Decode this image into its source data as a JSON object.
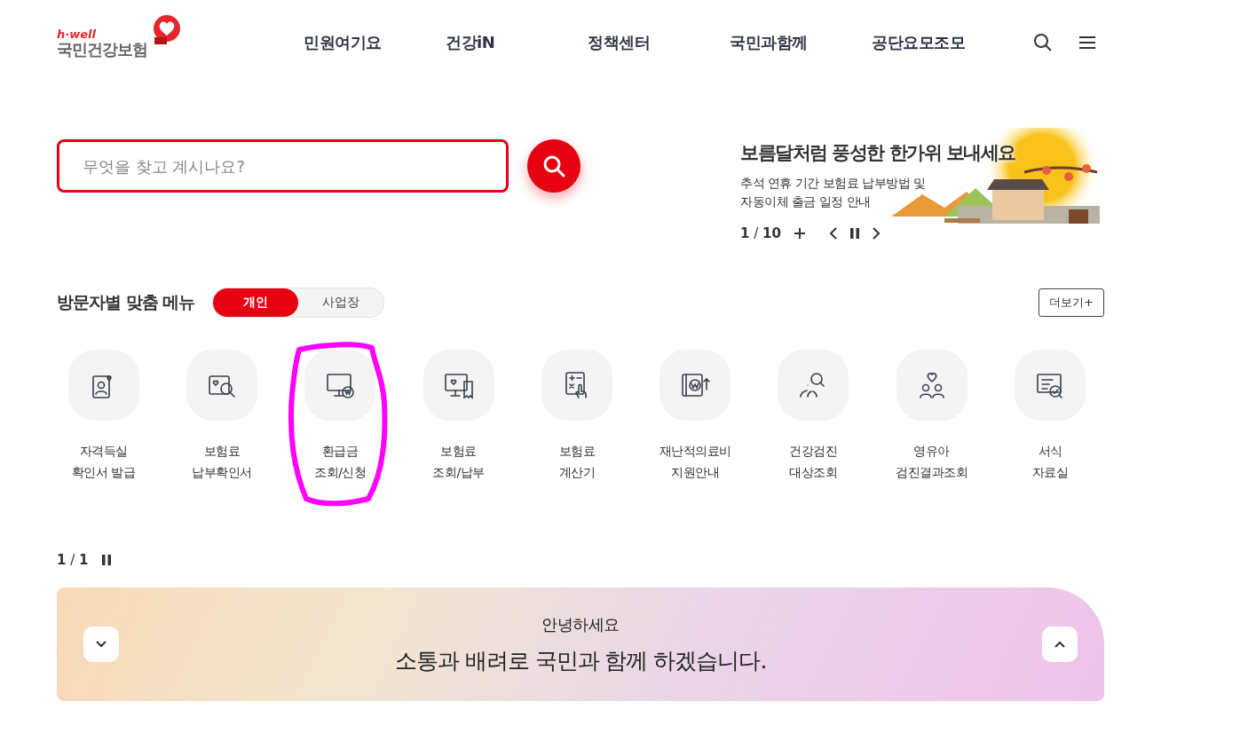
{
  "logo": {
    "tagline": "h·well",
    "name": "국민건강보험"
  },
  "nav": [
    "민원여기요",
    "건강iN",
    "정책센터",
    "국민과함께",
    "공단요모조모"
  ],
  "search": {
    "placeholder": "무엇을 찾고 계시나요?"
  },
  "promo": {
    "title": "보름달처럼 풍성한 한가위 보내세요",
    "lines": [
      "추석 연휴 기간 보험료 납부방법 및",
      "자동이체 출금 일정 안내"
    ],
    "counter": "**1** / **10**"
  },
  "menu": {
    "title": "방문자별 맞춤 메뉴",
    "more": "더보기+",
    "tabs": [
      {
        "label": "개인",
        "selected": true
      },
      {
        "label": "사업장",
        "selected": false
      }
    ],
    "items": [
      {
        "kind": "id-card",
        "lines": [
          "자격득실",
          "확인서 발급"
        ],
        "circled": false
      },
      {
        "kind": "search-doc",
        "lines": [
          "보험료",
          "납부확인서"
        ],
        "circled": false
      },
      {
        "kind": "monitor-won",
        "lines": [
          "환급금",
          "조회/신청"
        ],
        "circled": true
      },
      {
        "kind": "monitor-receipt",
        "lines": [
          "보험료",
          "조회/납부"
        ],
        "circled": false
      },
      {
        "kind": "calculator",
        "lines": [
          "보험료",
          "계산기"
        ],
        "circled": false
      },
      {
        "kind": "book-won",
        "lines": [
          "재난적의료비",
          "지원안내"
        ],
        "circled": false
      },
      {
        "kind": "people-search",
        "lines": [
          "건강검진",
          "대상조회"
        ],
        "circled": false
      },
      {
        "kind": "family",
        "lines": [
          "영유아",
          "검진결과조회"
        ],
        "circled": false
      },
      {
        "kind": "form-check",
        "lines": [
          "서식",
          "자료실"
        ],
        "circled": false
      }
    ],
    "pager": {
      "counter": "**1** / **1**"
    }
  },
  "greeting": {
    "small": "안녕하세요",
    "large": "소통과 배려로 국민과 함께 하겠습니다."
  }
}
